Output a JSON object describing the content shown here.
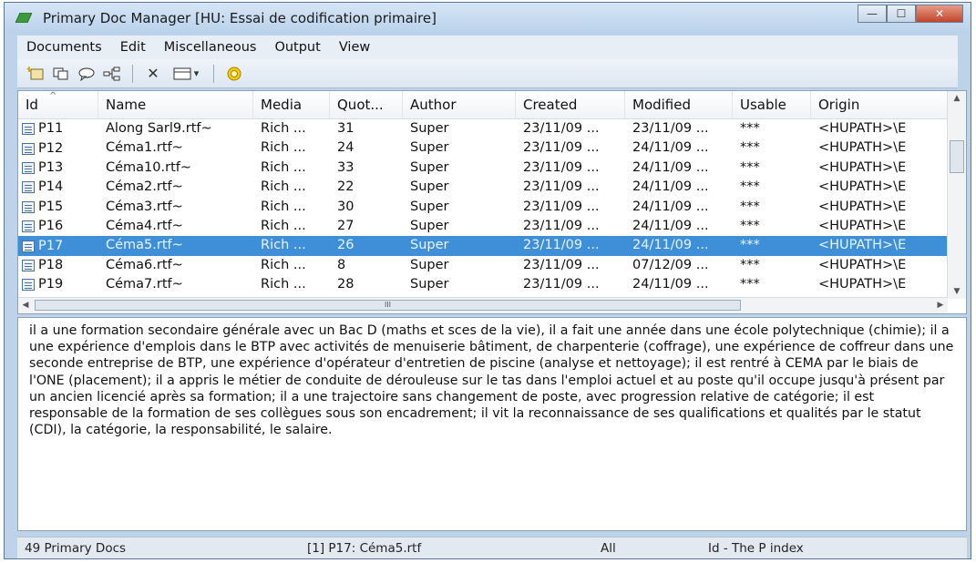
{
  "window": {
    "title": "Primary Doc Manager [HU: Essai de codification primaire]",
    "controls": {
      "minimize": "—",
      "maximize": "☐",
      "close": "✕"
    }
  },
  "menu": [
    "Documents",
    "Edit",
    "Miscellaneous",
    "Output",
    "View"
  ],
  "toolbar": {
    "icons": [
      "new-document-icon",
      "copy-icon",
      "comment-icon",
      "tree-icon",
      "delete-icon",
      "view-dropdown-icon",
      "filter-ring-icon"
    ],
    "delete_glyph": "✕",
    "dropdown_glyph": "▾"
  },
  "table": {
    "columns": [
      "Id",
      "Name",
      "Media",
      "Quot...",
      "Author",
      "Created",
      "Modified",
      "Usable",
      "Origin"
    ],
    "sort_indicator": "^",
    "rows": [
      [
        "P11",
        "Along Sarl9.rtf~",
        "Rich ...",
        "31",
        "Super",
        "23/11/09 ...",
        "23/11/09 ...",
        "***",
        "<HUPATH>\\E"
      ],
      [
        "P12",
        "Céma1.rtf~",
        "Rich ...",
        "24",
        "Super",
        "23/11/09 ...",
        "24/11/09 ...",
        "***",
        "<HUPATH>\\E"
      ],
      [
        "P13",
        "Céma10.rtf~",
        "Rich ...",
        "33",
        "Super",
        "23/11/09 ...",
        "24/11/09 ...",
        "***",
        "<HUPATH>\\E"
      ],
      [
        "P14",
        "Céma2.rtf~",
        "Rich ...",
        "22",
        "Super",
        "23/11/09 ...",
        "24/11/09 ...",
        "***",
        "<HUPATH>\\E"
      ],
      [
        "P15",
        "Céma3.rtf~",
        "Rich ...",
        "30",
        "Super",
        "23/11/09 ...",
        "24/11/09 ...",
        "***",
        "<HUPATH>\\E"
      ],
      [
        "P16",
        "Céma4.rtf~",
        "Rich ...",
        "27",
        "Super",
        "23/11/09 ...",
        "24/11/09 ...",
        "***",
        "<HUPATH>\\E"
      ],
      [
        "P17",
        "Céma5.rtf~",
        "Rich ...",
        "26",
        "Super",
        "23/11/09 ...",
        "24/11/09 ...",
        "***",
        "<HUPATH>\\E"
      ],
      [
        "P18",
        "Céma6.rtf~",
        "Rich ...",
        "8",
        "Super",
        "23/11/09 ...",
        "07/12/09 ...",
        "***",
        "<HUPATH>\\E"
      ],
      [
        "P19",
        "Céma7.rtf~",
        "Rich ...",
        "28",
        "Super",
        "23/11/09 ...",
        "24/11/09 ...",
        "***",
        "<HUPATH>\\E"
      ]
    ],
    "selected_row": 6,
    "hscroll_grip": "III"
  },
  "memo": "il a une formation secondaire générale avec un Bac D (maths et sces de la vie), il a fait une année dans une école polytechnique (chimie); il a une expérience d'emplois dans le BTP avec activités de menuiserie bâtiment, de charpenterie (coffrage), une expérience de coffreur dans une seconde entreprise de BTP, une expérience d'opérateur d'entretien de piscine (analyse et nettoyage); il est rentré à CEMA par le biais de l'ONE (placement); il a appris le métier de conduite de dérouleuse sur le tas dans l'emploi actuel et au poste qu'il occupe jusqu'à présent par un ancien licencié après sa formation; il a une trajectoire sans changement de poste, avec progression relative de catégorie; il est responsable de la formation de ses collègues sous son encadrement; il vit la reconnaissance de ses qualifications et qualités par le statut (CDI), la catégorie, la responsabilité, le salaire.",
  "status": {
    "count": "49 Primary Docs",
    "current": "[1] P17: Céma5.rtf",
    "filter": "All",
    "sort": "Id - The P index"
  },
  "colors": {
    "selection": "#3f8fd8",
    "frame": "#bcd3ea"
  }
}
